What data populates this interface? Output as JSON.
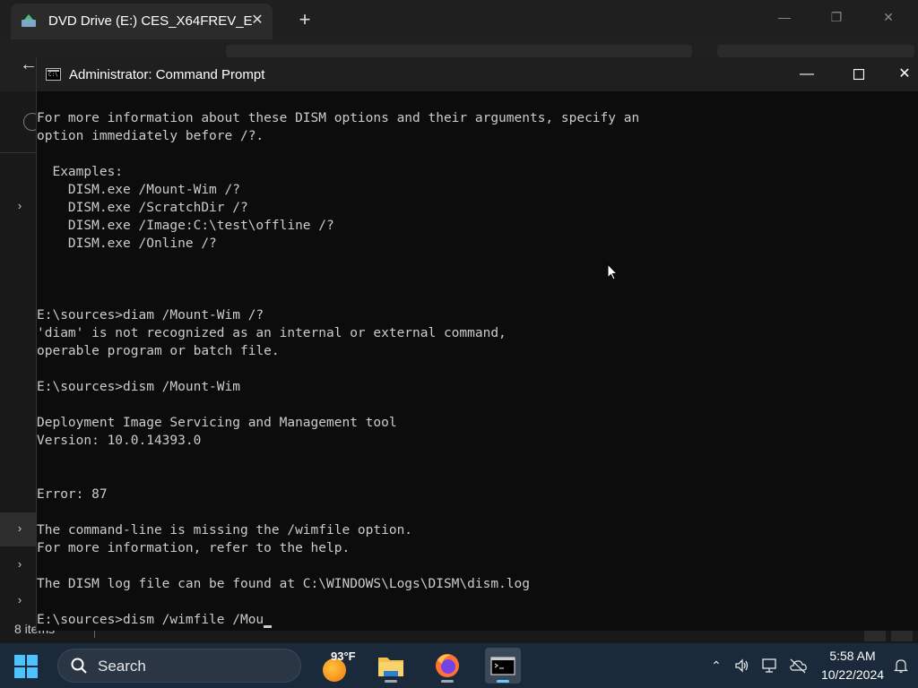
{
  "explorer": {
    "tab_title": "DVD Drive (E:) CES_X64FREV_E",
    "close_glyph": "✕",
    "new_tab_glyph": "+",
    "back_glyph": "←",
    "status": "8 items",
    "nav_chevron": "›"
  },
  "cmd": {
    "title": "Administrator: Command Prompt",
    "icon_text": "C:\\",
    "minimize_glyph": "—",
    "close_glyph": "✕",
    "lines": [
      "For more information about these DISM options and their arguments, specify an",
      "option immediately before /?.",
      "",
      "  Examples:",
      "    DISM.exe /Mount-Wim /?",
      "    DISM.exe /ScratchDir /?",
      "    DISM.exe /Image:C:\\test\\offline /?",
      "    DISM.exe /Online /?",
      "",
      "",
      "",
      "E:\\sources>diam /Mount-Wim /?",
      "'diam' is not recognized as an internal or external command,",
      "operable program or batch file.",
      "",
      "E:\\sources>dism /Mount-Wim",
      "",
      "Deployment Image Servicing and Management tool",
      "Version: 10.0.14393.0",
      "",
      "",
      "Error: 87",
      "",
      "The command-line is missing the /wimfile option.",
      "For more information, refer to the help.",
      "",
      "The DISM log file can be found at C:\\WINDOWS\\Logs\\DISM\\dism.log",
      "",
      "E:\\sources>dism /wimfile /Mou"
    ]
  },
  "taskbar": {
    "search_label": "Search",
    "weather_temp": "93°F",
    "time": "5:58 AM",
    "date": "10/22/2024",
    "tray_icons": [
      "chevron-up-icon",
      "volume-icon",
      "network-icon",
      "cloud-offline-icon",
      "notification-bell-icon"
    ]
  },
  "colors": {
    "console_bg": "#0c0c0c",
    "console_text": "#cccccc",
    "titlebar": "#1f1f1f",
    "taskbar": "#1a2a3a"
  }
}
